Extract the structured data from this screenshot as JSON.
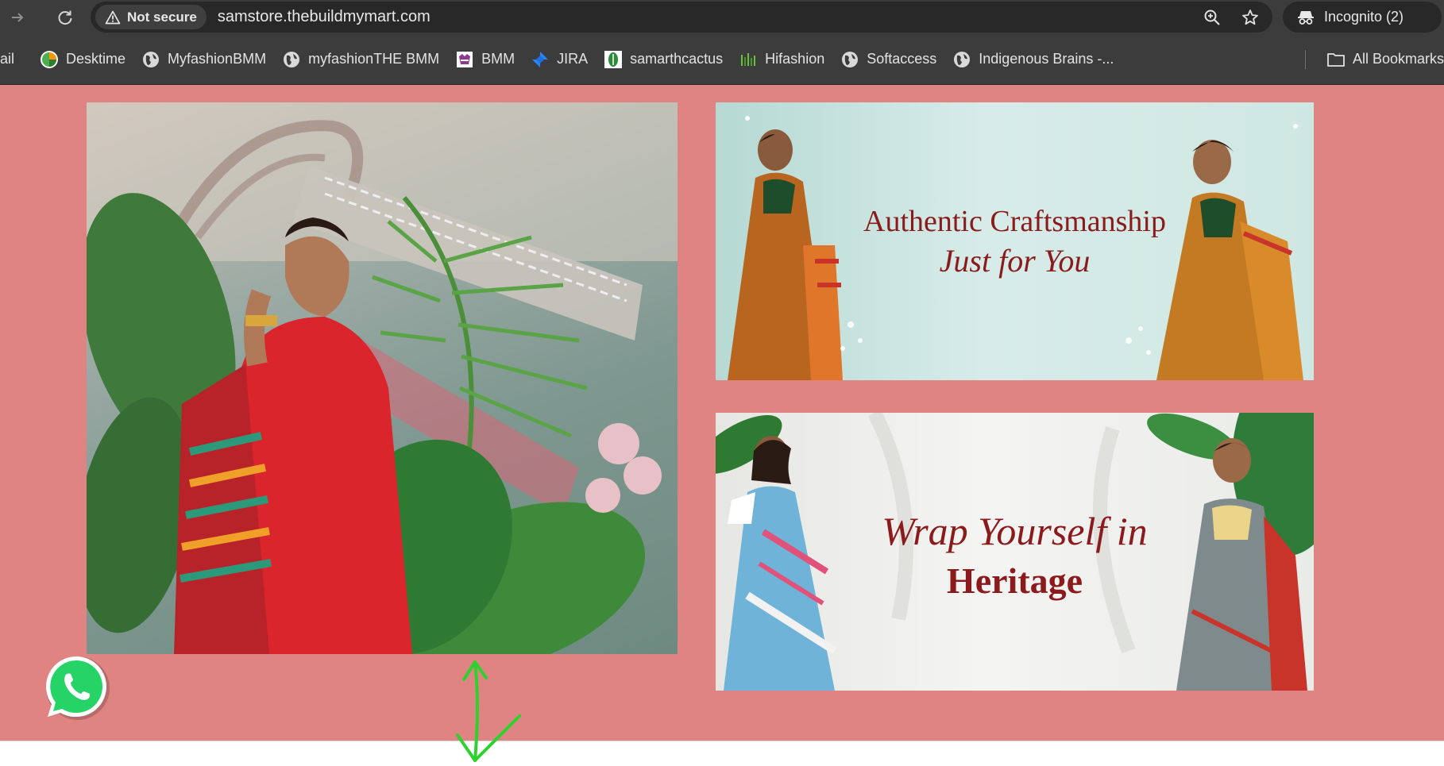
{
  "browser": {
    "security_label": "Not secure",
    "url": "samstore.thebuildmymart.com",
    "incognito_label": "Incognito (2)"
  },
  "bookmarks": {
    "items": [
      {
        "label": "ail",
        "icon": "none"
      },
      {
        "label": "Desktime",
        "icon": "desktime-icon"
      },
      {
        "label": "MyfashionBMM",
        "icon": "globe-icon"
      },
      {
        "label": "myfashionTHE BMM",
        "icon": "globe-icon"
      },
      {
        "label": "BMM",
        "icon": "bmm-icon"
      },
      {
        "label": "JIRA",
        "icon": "jira-icon"
      },
      {
        "label": "samarthcactus",
        "icon": "cactus-icon"
      },
      {
        "label": "Hifashion",
        "icon": "hifashion-icon"
      },
      {
        "label": "Softaccess",
        "icon": "globe-icon"
      },
      {
        "label": "Indigenous Brains -...",
        "icon": "globe-icon"
      }
    ],
    "all_bookmarks_label": "All Bookmarks"
  },
  "banners": {
    "top": {
      "line1": "Authentic Craftsmanship",
      "line2": "Just for You"
    },
    "bottom": {
      "line1": "Wrap Yourself in",
      "line2": "Heritage"
    }
  },
  "colors": {
    "page_bg": "#e08483",
    "banner_text": "#8b1a1c",
    "browser_chrome": "#3c3c3c",
    "whatsapp_green": "#25d366"
  }
}
